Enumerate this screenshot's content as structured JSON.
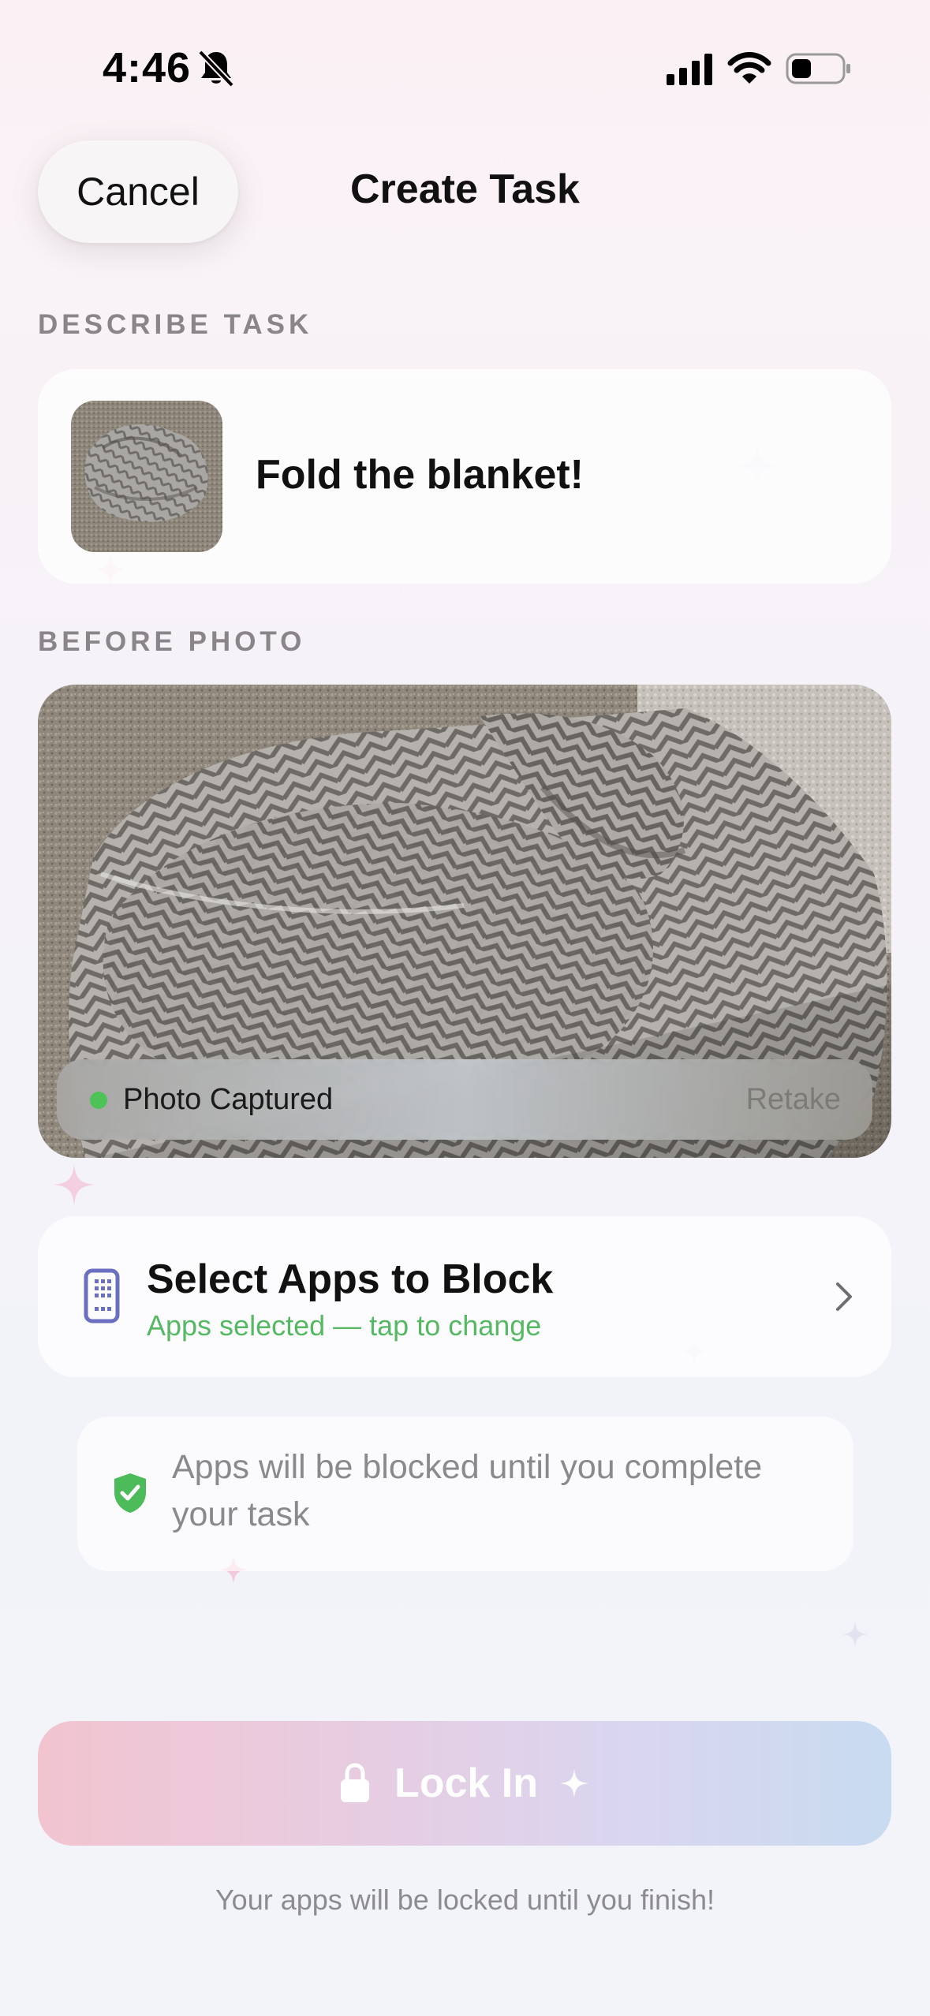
{
  "status_bar": {
    "time": "4:46"
  },
  "header": {
    "cancel_label": "Cancel",
    "title": "Create Task"
  },
  "describe_section": {
    "label": "DESCRIBE TASK",
    "task_text": "Fold the blanket!"
  },
  "photo_section": {
    "label": "BEFORE PHOTO",
    "status": "Photo Captured",
    "retake_label": "Retake",
    "status_color": "#4cc257"
  },
  "apps_card": {
    "title": "Select Apps to Block",
    "subtitle": "Apps selected — tap to change",
    "subtitle_color": "#56b864"
  },
  "info": {
    "text": "Apps will be blocked until you complete your task"
  },
  "lock_button": {
    "label": "Lock In"
  },
  "footer": {
    "note": "Your apps will be locked until you finish!"
  },
  "icons": [
    "bell-slash-icon",
    "signal-icon",
    "wifi-icon",
    "battery-icon",
    "phone-grid-icon",
    "chevron-right-icon",
    "shield-check-icon",
    "lock-icon",
    "sparkle-icon"
  ]
}
